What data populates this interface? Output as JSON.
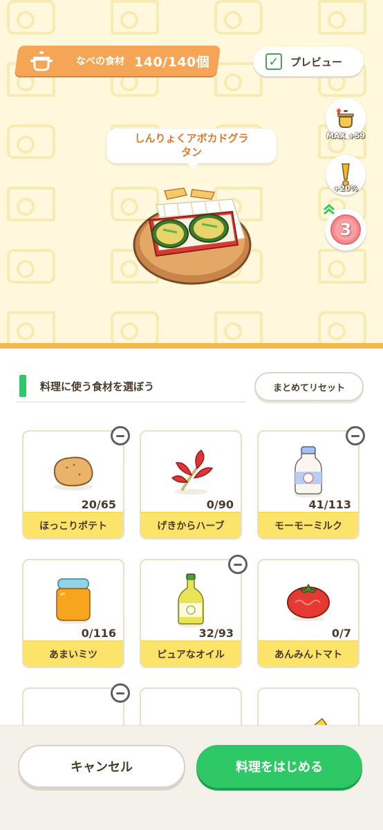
{
  "header": {
    "pot_label": "なべの食材",
    "pot_count": "140/140個",
    "preview_label": "プレビュー",
    "preview_checked": true
  },
  "side_buttons": [
    {
      "icon": "pot-upgrade-icon",
      "caption": "MAX +59"
    },
    {
      "icon": "exclamation-icon",
      "caption": "+20%"
    },
    {
      "icon": "level-badge-icon",
      "caption": "3"
    }
  ],
  "dish": {
    "name": "しんりょくアボカドグラタン",
    "name_line1": "しんりょくアボカドグラ",
    "name_line2": "タン"
  },
  "section": {
    "title": "料理に使う食材を選ぼう",
    "reset_label": "まとめてリセット"
  },
  "ingredients": [
    {
      "name": "ほっこりポテト",
      "count": "20/65",
      "icon": "potato-icon",
      "has_minus": true
    },
    {
      "name": "げきからハーブ",
      "count": "0/90",
      "icon": "herb-icon",
      "has_minus": false
    },
    {
      "name": "モーモーミルク",
      "count": "41/113",
      "icon": "milk-icon",
      "has_minus": true
    },
    {
      "name": "あまいミツ",
      "count": "0/116",
      "icon": "honey-icon",
      "has_minus": false
    },
    {
      "name": "ピュアなオイル",
      "count": "32/93",
      "icon": "oil-icon",
      "has_minus": true
    },
    {
      "name": "あんみんトマト",
      "count": "0/7",
      "icon": "tomato-icon",
      "has_minus": false
    },
    {
      "name": "",
      "count": "",
      "icon": "pumpkin-icon",
      "has_minus": true
    },
    {
      "name": "",
      "count": "",
      "icon": "egg-icon",
      "has_minus": false
    },
    {
      "name": "",
      "count": "",
      "icon": "corn-icon",
      "has_minus": false
    }
  ],
  "footer": {
    "cancel_label": "キャンセル",
    "start_label": "料理をはじめる"
  },
  "colors": {
    "accent_orange": "#f5a556",
    "accent_green": "#2ec966",
    "label_yellow": "#fce36a"
  }
}
